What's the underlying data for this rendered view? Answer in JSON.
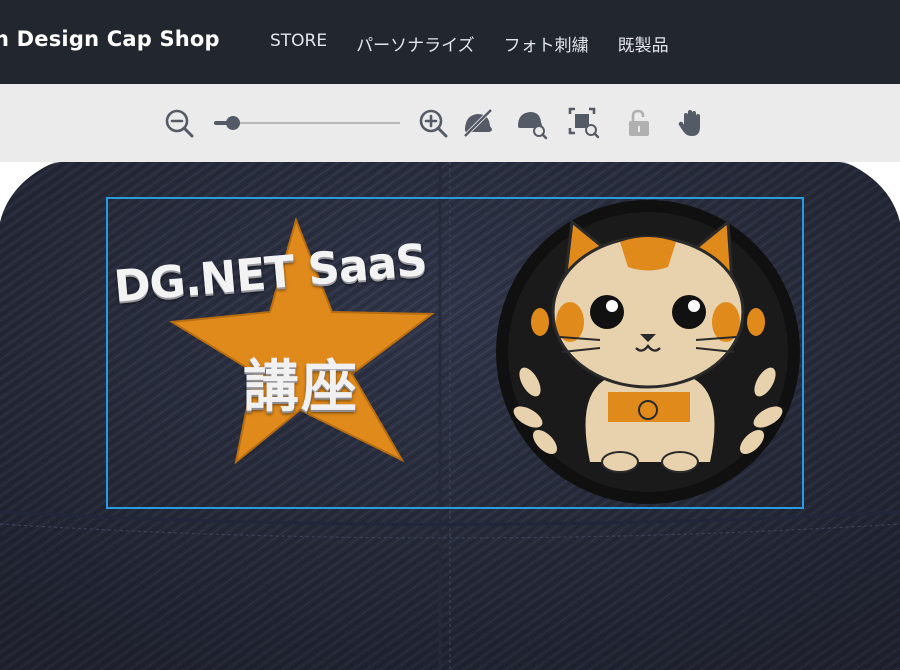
{
  "header": {
    "brand": "n Design Cap Shop",
    "nav": [
      "STORE",
      "パーソナライズ",
      "フォト刺繍",
      "既製品"
    ]
  },
  "toolbar": {
    "zoom_level": 0.1,
    "icons": [
      "zoom-out-icon",
      "zoom-in-icon",
      "hide-cap-icon",
      "cap-preview-icon",
      "fit-selection-icon",
      "unlock-icon",
      "pan-hand-icon"
    ]
  },
  "canvas": {
    "design_text": "DG.NET SaaS",
    "design_kanji": "講座",
    "cap_color": "#2f3447",
    "star_color": "#e08a1c",
    "selection_color": "#2b9be0"
  },
  "colors": {
    "nav_bg": "#22262f",
    "toolbar_bg": "#ebebeb"
  }
}
